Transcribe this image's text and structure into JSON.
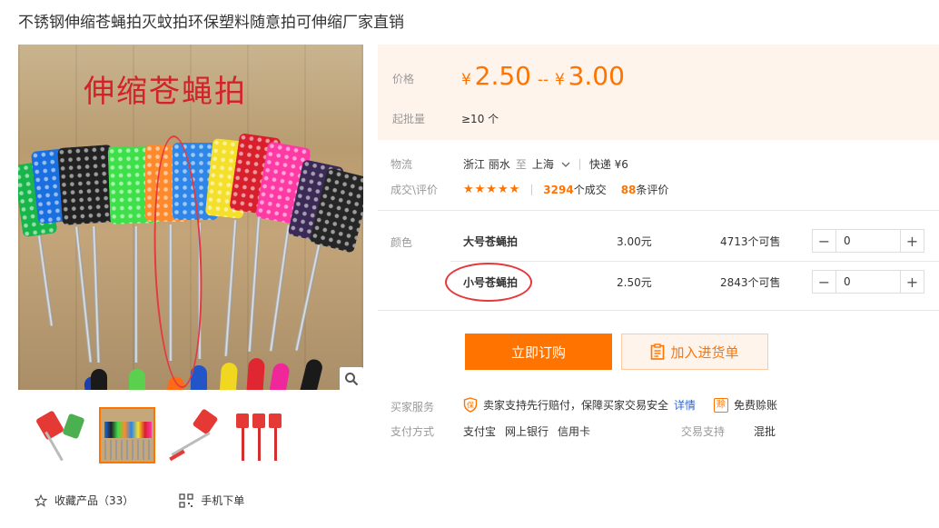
{
  "product": {
    "title": "不锈钢伸缩苍蝇拍灭蚊拍环保塑料随意拍可伸缩厂家直销"
  },
  "gallery": {
    "image_caption": "伸缩苍蝇拍",
    "zoom_icon": "magnifier-icon",
    "thumbnail_count": 4,
    "active_thumbnail": 2
  },
  "bottom_links": {
    "favorite_label": "收藏产品（33）",
    "mobile_label": "手机下单"
  },
  "price_box": {
    "price_label": "价格",
    "currency": "¥",
    "price_low": "2.50",
    "price_separator": "--",
    "price_high": "3.00",
    "moq_label": "起批量",
    "moq_value": "≥10 个"
  },
  "logistics": {
    "label": "物流",
    "from": "浙江 丽水",
    "to_word": "至",
    "destination": "上海",
    "express": "快递 ¥6"
  },
  "rating": {
    "label": "成交\\评价",
    "stars": "★★★★★",
    "deals_count": "3294",
    "deals_suffix": "个成交",
    "reviews_count": "88",
    "reviews_suffix": "条评价"
  },
  "variants": {
    "label": "颜色",
    "items": [
      {
        "name": "大号苍蝇拍",
        "price": "3.00元",
        "stock": "4713个可售",
        "qty": "0"
      },
      {
        "name": "小号苍蝇拍",
        "price": "2.50元",
        "stock": "2843个可售",
        "qty": "0"
      }
    ]
  },
  "actions": {
    "buy_label": "立即订购",
    "cart_label": "加入进货单"
  },
  "services": {
    "label": "买家服务",
    "protection_text": "卖家支持先行赔付，保障买家交易安全",
    "details_link": "详情",
    "free_credit_text": "免费赊账"
  },
  "payment": {
    "label": "支付方式",
    "methods": [
      "支付宝",
      "网上银行",
      "信用卡"
    ],
    "trade_support_label": "交易支持",
    "trade_support_value": "混批"
  },
  "colors": {
    "accent": "#ff7300",
    "price_bg": "#fff4ec",
    "annotation_red": "#e5393e",
    "link": "#3366cc"
  }
}
